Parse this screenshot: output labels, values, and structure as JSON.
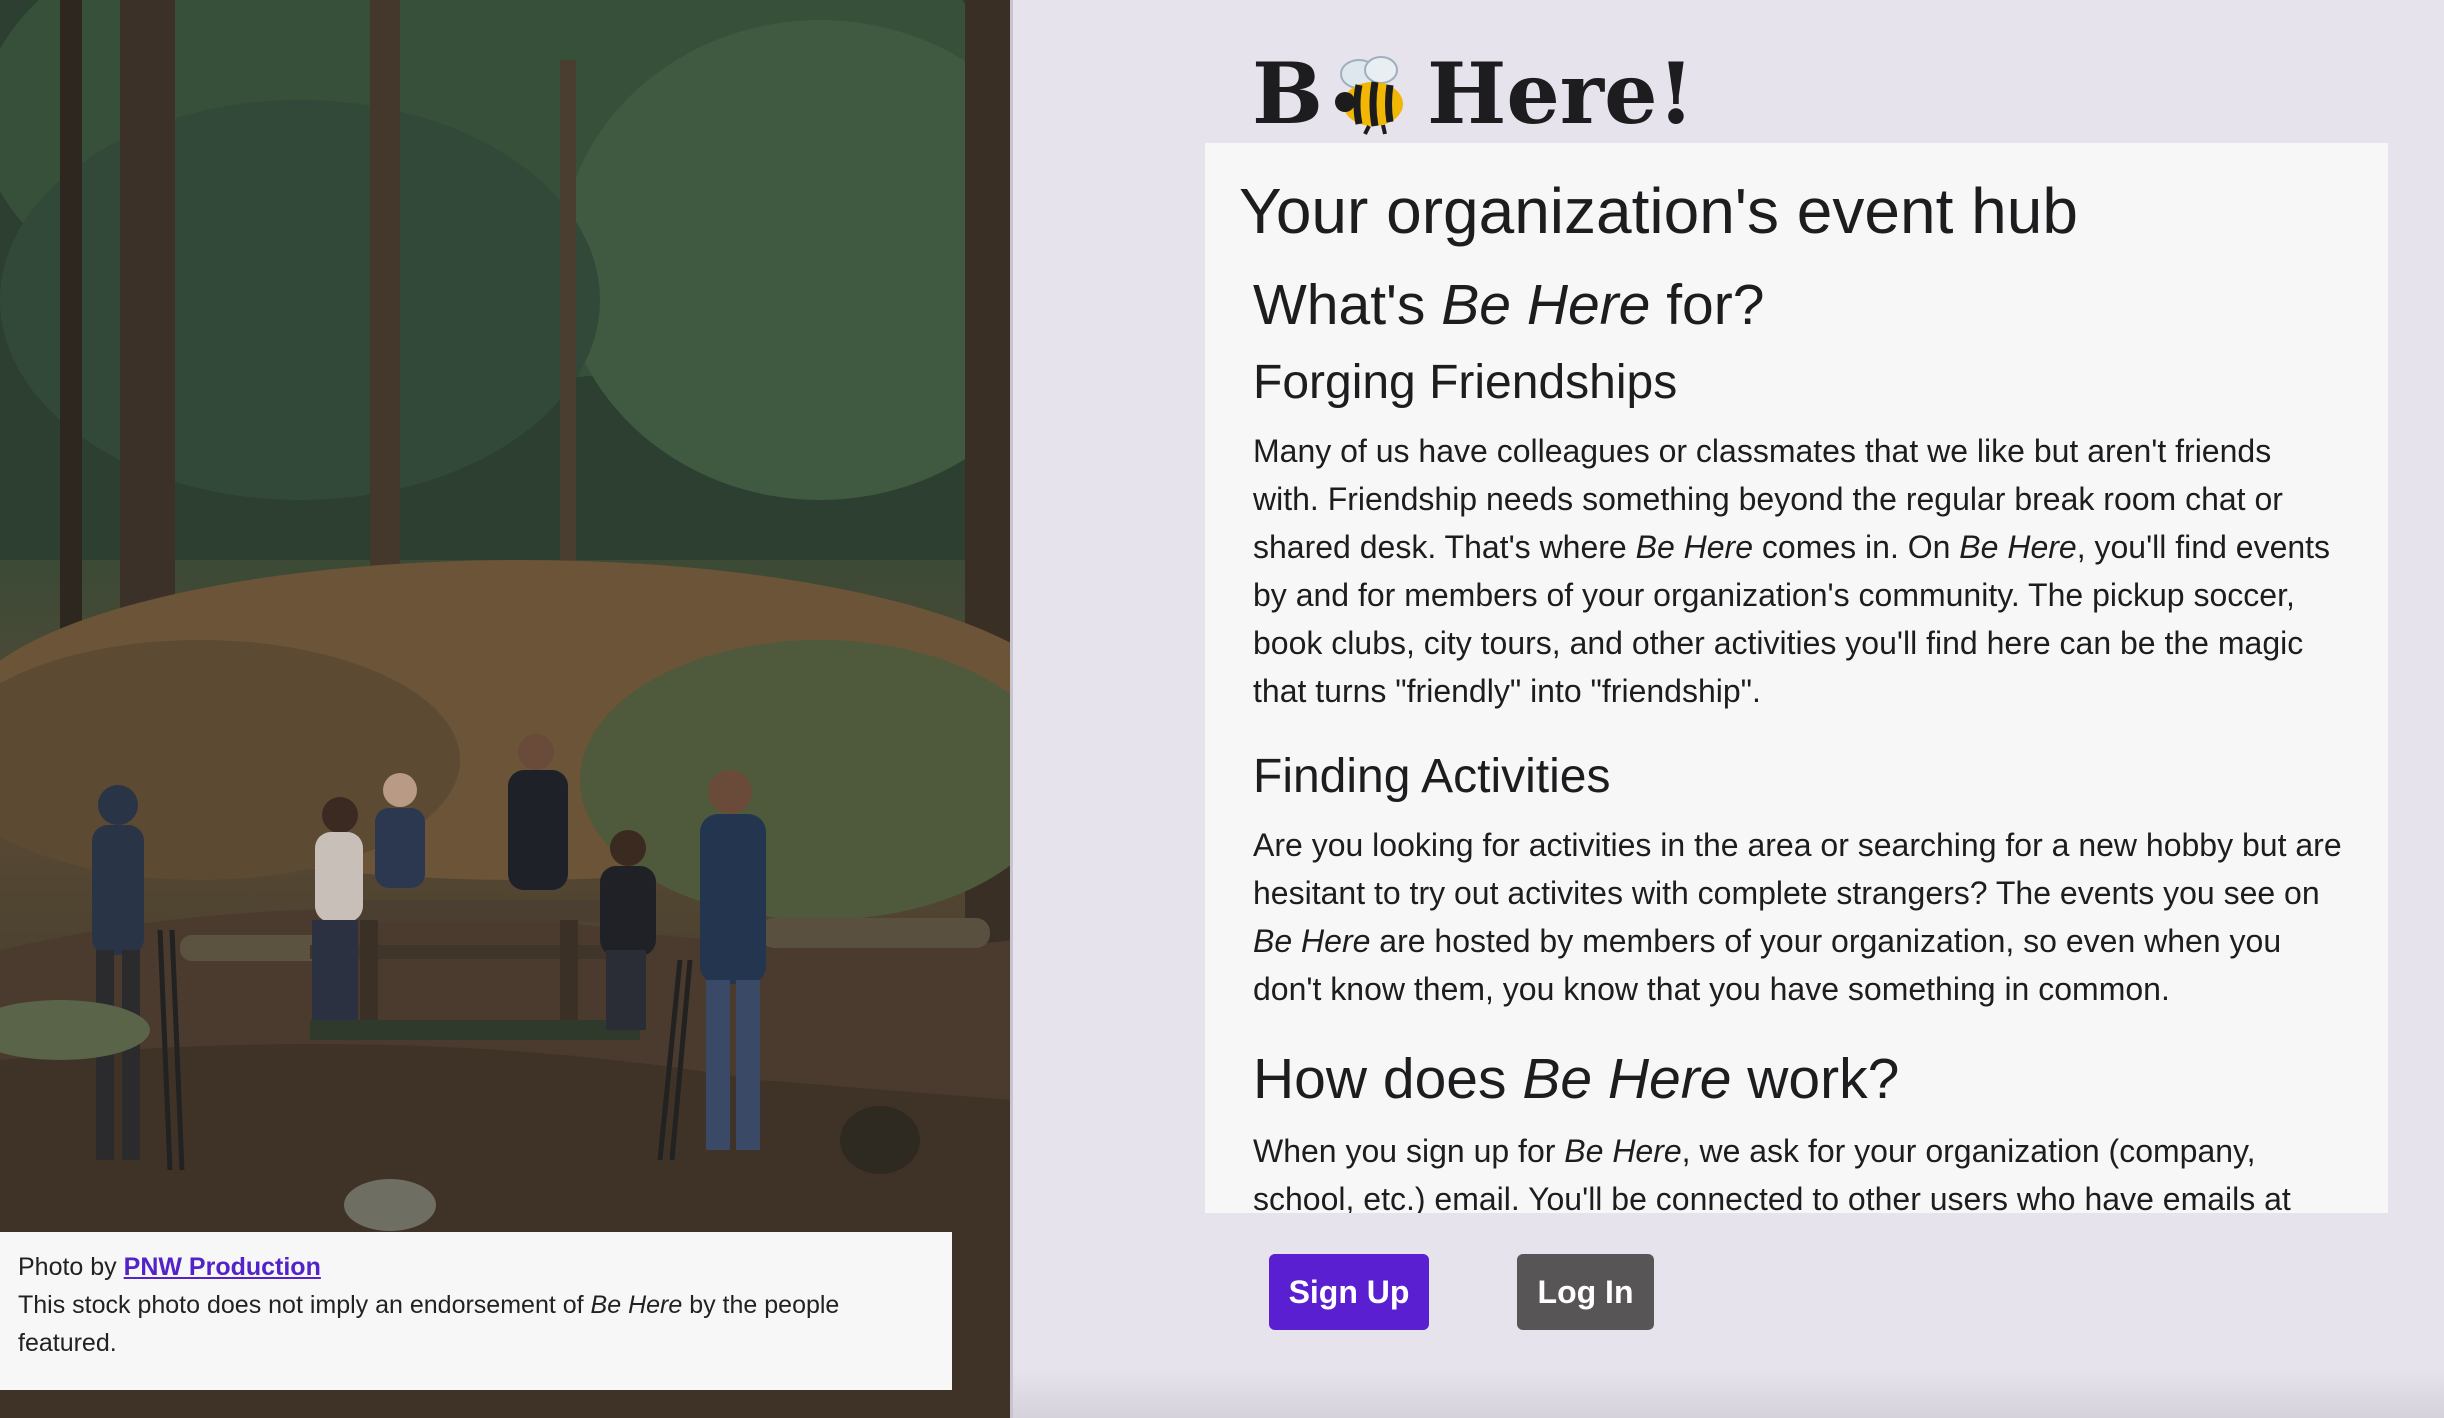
{
  "photo": {
    "alt": "Group of hikers gathered around a picnic table in a forest",
    "caption_prefix": "Photo by ",
    "credit_link": "PNW Production",
    "disclaimer_before": "This stock photo does not imply an endorsement of ",
    "disclaimer_em": "Be Here",
    "disclaimer_after": " by the people featured."
  },
  "logo": {
    "text_before": "B",
    "icon": "bee-icon",
    "text_after": "Here!"
  },
  "hero": {
    "title": "Your organization's event hub"
  },
  "sections": {
    "whats_for": {
      "before": "What's ",
      "em": "Be Here",
      "after": " for?"
    },
    "friendships": {
      "heading": "Forging Friendships",
      "p1": "Many of us have colleagues or classmates that we like but aren't friends with. Friendship needs something beyond the regular break room chat or shared desk. That's where ",
      "em1": "Be Here",
      "p2": " comes in. On ",
      "em2": "Be Here",
      "p3": ", you'll find events by and for members of your organization's community. The pickup soccer, book clubs, city tours, and other activities you'll find here can be the magic that turns \"friendly\" into \"friendship\"."
    },
    "activities": {
      "heading": "Finding Activities",
      "p1": "Are you looking for activities in the area or searching for a new hobby but are hesitant to try out activites with complete strangers? The events you see on ",
      "em1": "Be Here",
      "p2": " are hosted by members of your organization, so even when you don't know them, you know that you have something in common."
    },
    "how": {
      "before": "How does ",
      "em": "Be Here",
      "after": " work?",
      "p1": "When you sign up for ",
      "em1": "Be Here",
      "p2": ", we ask for your organization (company, school, etc.) email. You'll be connected to other users who have emails at the same"
    }
  },
  "buttons": {
    "signup": "Sign Up",
    "login": "Log In"
  },
  "colors": {
    "accent": "#5a1fd1",
    "login": "#575555",
    "background": "#e6e3ec",
    "card": "#f7f7f8"
  }
}
